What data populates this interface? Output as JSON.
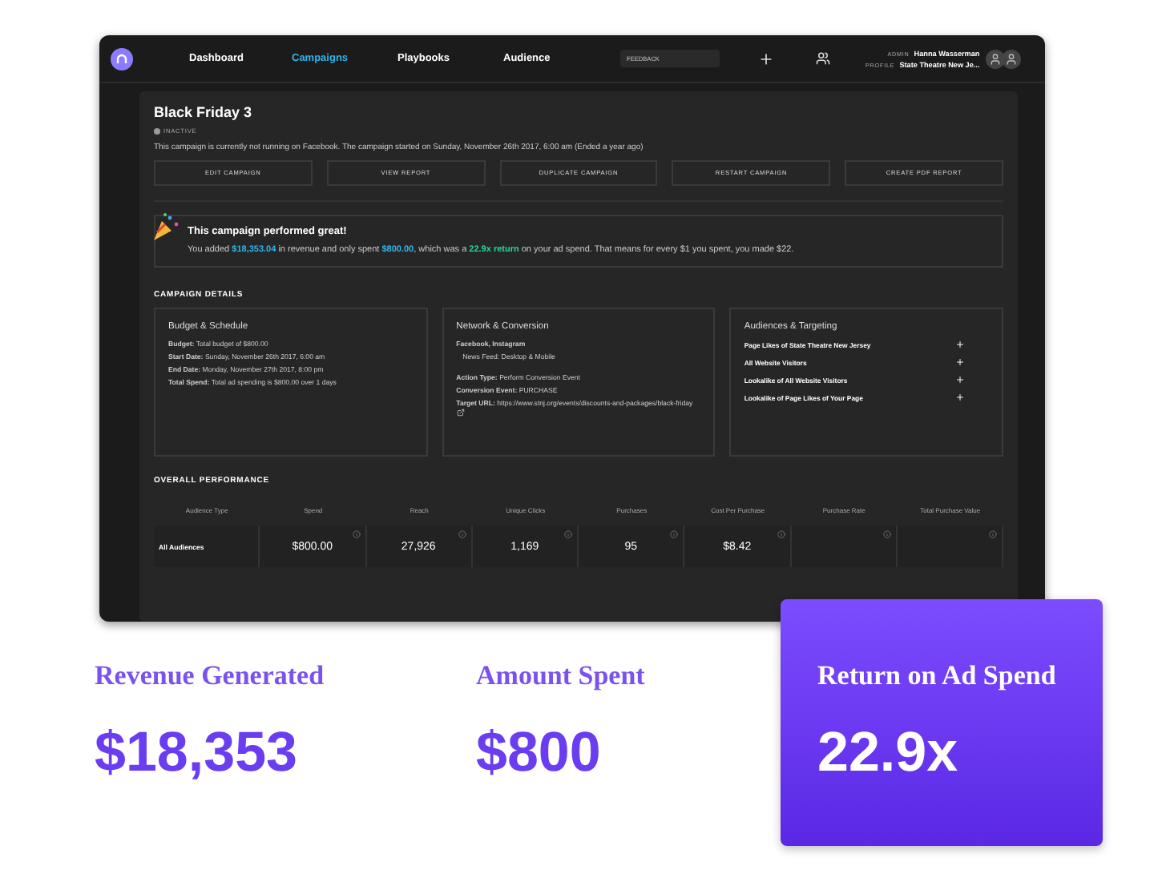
{
  "nav": {
    "items": [
      {
        "label": "Dashboard",
        "selected": false
      },
      {
        "label": "Campaigns",
        "selected": true
      },
      {
        "label": "Playbooks",
        "selected": false
      },
      {
        "label": "Audience",
        "selected": false
      }
    ],
    "feedback": "FEEDBACK",
    "user": [
      {
        "role": "ADMIN",
        "value": "Hanna Wasserman"
      },
      {
        "role": "PROFILE",
        "value": "State Theatre New Je..."
      }
    ]
  },
  "campaign": {
    "title": "Black Friday 3",
    "status": "INACTIVE",
    "active": false,
    "description": "This campaign is currently not running on Facebook. The campaign started on Sunday, November 26th 2017, 6:00 am (Ended a year ago)",
    "actions": [
      "EDIT CAMPAIGN",
      "VIEW REPORT",
      "DUPLICATE CAMPAIGN",
      "RESTART CAMPAIGN",
      "CREATE PDF REPORT"
    ]
  },
  "result": {
    "title": "This campaign performed great!",
    "message": [
      {
        "kind": "plain",
        "text": "You added "
      },
      {
        "kind": "money",
        "text": "$18,353.04"
      },
      {
        "kind": "plain",
        "text": " in revenue and only spent "
      },
      {
        "kind": "money",
        "text": "$800.00"
      },
      {
        "kind": "plain",
        "text": ", which was a "
      },
      {
        "kind": "return",
        "text": "22.9x return"
      },
      {
        "kind": "plain",
        "text": " on your ad spend. That means for every $1 you spent, you made $22."
      }
    ]
  },
  "details": {
    "heading": "CAMPAIGN DETAILS",
    "budget": {
      "title": "Budget & Schedule",
      "lines": [
        {
          "label": "Budget:",
          "value": "Total budget of $800.00"
        },
        {
          "label": "Start Date:",
          "value": "Sunday, November 26th 2017, 6:00 am"
        },
        {
          "label": "End Date:",
          "value": "Monday, November 27th 2017, 8:00 pm"
        },
        {
          "label": "Total Spend:",
          "value": "Total ad spending is $800.00 over 1 days"
        }
      ]
    },
    "network": {
      "title": "Network & Conversion",
      "platforms": "Facebook, Instagram",
      "placement": "News Feed: Desktop & Mobile",
      "lines": [
        {
          "label": "Action Type:",
          "value": "Perform Conversion Event"
        },
        {
          "label": "Conversion Event:",
          "value": "PURCHASE"
        },
        {
          "label": "Target URL:",
          "value": "https://www.stnj.org/events/discounts-and-packages/black-friday",
          "link": true
        }
      ]
    },
    "audiences": {
      "title": "Audiences & Targeting",
      "items": [
        "Page Likes of State Theatre New Jersey",
        "All Website Visitors",
        "Lookalike of All Website Visitors",
        "Lookalike of Page Likes of Your Page"
      ]
    }
  },
  "performance": {
    "heading": "OVERALL PERFORMANCE",
    "columns": [
      "Audience Type",
      "Spend",
      "Reach",
      "Unique Clicks",
      "Purchases",
      "Cost Per Purchase",
      "Purchase Rate",
      "Total Purchase Value"
    ],
    "row": [
      "All Audiences",
      "$800.00",
      "27,926",
      "1,169",
      "95",
      "$8.42"
    ]
  },
  "stats": [
    {
      "kind": "plain",
      "label": "Revenue Generated",
      "value": "$18,353"
    },
    {
      "kind": "plain",
      "label": "Amount Spent",
      "value": "$800"
    },
    {
      "kind": "highlight",
      "label": "Return on Ad Spend",
      "value": "22.9x"
    }
  ]
}
